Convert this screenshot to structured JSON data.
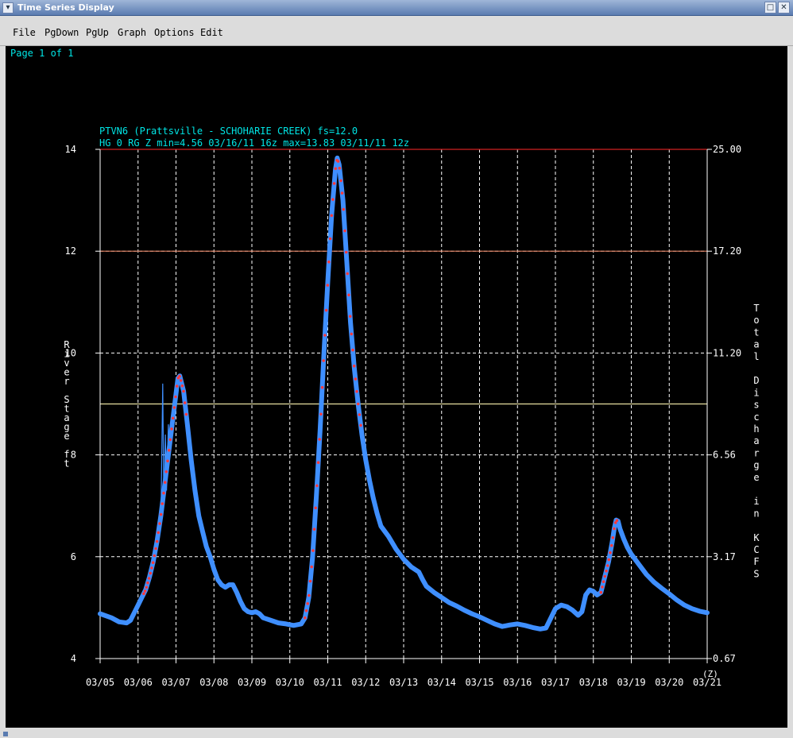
{
  "window": {
    "title": "Time Series Display",
    "sys_icon": "chevron-down-icon",
    "buttons": [
      "maximize-icon",
      "close-icon"
    ]
  },
  "menu": [
    "File",
    "PgDown",
    "PgUp",
    "Graph",
    "Options",
    "Edit"
  ],
  "page_indicator": "Page 1 of 1",
  "colors": {
    "background": "#000000",
    "grid": "#ffffff",
    "text": "#ffffff",
    "header": "#00e5e5",
    "observed": "#3f8fff",
    "marker": "#ff3a3a",
    "line_major": "#d02020",
    "line_moderate": "#e08060",
    "line_flood": "#e8e0a0"
  },
  "chart_data": {
    "type": "line",
    "header_line1": "PTVN6 (Prattsville - SCHOHARIE CREEK) fs=12.0",
    "header_line2": "HG 0 RG Z min=4.56 03/16/11 16z max=13.83 03/11/11 12z",
    "ylabel_left": "River Stage ft",
    "ylabel_right": "Total Discharge in KCFS",
    "x_unit": "(Z)",
    "x_ticks": [
      "03/05",
      "03/06",
      "03/07",
      "03/08",
      "03/09",
      "03/10",
      "03/11",
      "03/12",
      "03/13",
      "03/14",
      "03/15",
      "03/16",
      "03/17",
      "03/18",
      "03/19",
      "03/20",
      "03/21"
    ],
    "y_ticks_left": [
      "4",
      "6",
      "8",
      "10",
      "12",
      "14"
    ],
    "y_ticks_right": [
      "0.67",
      "3.17",
      "6.56",
      "11.20",
      "17.20",
      "25.00"
    ],
    "ylim": [
      4,
      14
    ],
    "xlim_days": [
      0,
      16
    ],
    "threshold_lines": [
      {
        "value": 14.0,
        "kind": "major"
      },
      {
        "value": 12.0,
        "kind": "moderate"
      },
      {
        "value": 9.0,
        "kind": "flood"
      }
    ],
    "series": [
      {
        "name": "HG 0 RG Z",
        "points": [
          [
            0.0,
            4.88
          ],
          [
            0.3,
            4.8
          ],
          [
            0.5,
            4.72
          ],
          [
            0.7,
            4.7
          ],
          [
            0.8,
            4.75
          ],
          [
            0.9,
            4.9
          ],
          [
            1.0,
            5.05
          ],
          [
            1.1,
            5.2
          ],
          [
            1.2,
            5.35
          ],
          [
            1.3,
            5.6
          ],
          [
            1.4,
            5.9
          ],
          [
            1.5,
            6.3
          ],
          [
            1.6,
            6.8
          ],
          [
            1.7,
            7.4
          ],
          [
            1.8,
            8.0
          ],
          [
            1.9,
            8.6
          ],
          [
            2.0,
            9.2
          ],
          [
            2.05,
            9.5
          ],
          [
            2.1,
            9.55
          ],
          [
            2.2,
            9.25
          ],
          [
            2.3,
            8.6
          ],
          [
            2.4,
            7.9
          ],
          [
            2.5,
            7.3
          ],
          [
            2.6,
            6.8
          ],
          [
            2.7,
            6.5
          ],
          [
            2.8,
            6.2
          ],
          [
            2.9,
            6.0
          ],
          [
            3.0,
            5.75
          ],
          [
            3.1,
            5.55
          ],
          [
            3.2,
            5.45
          ],
          [
            3.3,
            5.4
          ],
          [
            3.4,
            5.45
          ],
          [
            3.5,
            5.45
          ],
          [
            3.6,
            5.3
          ],
          [
            3.7,
            5.12
          ],
          [
            3.8,
            4.98
          ],
          [
            3.9,
            4.92
          ],
          [
            4.0,
            4.9
          ],
          [
            4.1,
            4.92
          ],
          [
            4.2,
            4.88
          ],
          [
            4.3,
            4.8
          ],
          [
            4.5,
            4.75
          ],
          [
            4.7,
            4.7
          ],
          [
            4.9,
            4.68
          ],
          [
            5.1,
            4.65
          ],
          [
            5.3,
            4.68
          ],
          [
            5.4,
            4.8
          ],
          [
            5.5,
            5.2
          ],
          [
            5.6,
            6.0
          ],
          [
            5.7,
            7.2
          ],
          [
            5.8,
            8.5
          ],
          [
            5.9,
            10.0
          ],
          [
            6.0,
            11.4
          ],
          [
            6.1,
            12.7
          ],
          [
            6.2,
            13.6
          ],
          [
            6.25,
            13.83
          ],
          [
            6.3,
            13.7
          ],
          [
            6.4,
            13.0
          ],
          [
            6.5,
            11.8
          ],
          [
            6.6,
            10.6
          ],
          [
            6.7,
            9.7
          ],
          [
            6.8,
            9.0
          ],
          [
            6.9,
            8.4
          ],
          [
            7.0,
            7.9
          ],
          [
            7.1,
            7.5
          ],
          [
            7.2,
            7.15
          ],
          [
            7.3,
            6.85
          ],
          [
            7.4,
            6.6
          ],
          [
            7.6,
            6.4
          ],
          [
            7.8,
            6.15
          ],
          [
            8.0,
            5.95
          ],
          [
            8.2,
            5.8
          ],
          [
            8.4,
            5.7
          ],
          [
            8.5,
            5.55
          ],
          [
            8.6,
            5.42
          ],
          [
            8.8,
            5.3
          ],
          [
            9.0,
            5.2
          ],
          [
            9.2,
            5.1
          ],
          [
            9.4,
            5.03
          ],
          [
            9.6,
            4.95
          ],
          [
            9.8,
            4.88
          ],
          [
            10.0,
            4.82
          ],
          [
            10.2,
            4.75
          ],
          [
            10.4,
            4.68
          ],
          [
            10.6,
            4.63
          ],
          [
            10.8,
            4.66
          ],
          [
            11.0,
            4.68
          ],
          [
            11.2,
            4.65
          ],
          [
            11.4,
            4.61
          ],
          [
            11.6,
            4.58
          ],
          [
            11.75,
            4.6
          ],
          [
            11.85,
            4.75
          ],
          [
            12.0,
            4.98
          ],
          [
            12.15,
            5.05
          ],
          [
            12.3,
            5.02
          ],
          [
            12.45,
            4.95
          ],
          [
            12.6,
            4.85
          ],
          [
            12.7,
            4.92
          ],
          [
            12.8,
            5.25
          ],
          [
            12.9,
            5.35
          ],
          [
            13.0,
            5.32
          ],
          [
            13.1,
            5.25
          ],
          [
            13.2,
            5.3
          ],
          [
            13.3,
            5.6
          ],
          [
            13.4,
            5.9
          ],
          [
            13.5,
            6.3
          ],
          [
            13.55,
            6.55
          ],
          [
            13.6,
            6.72
          ],
          [
            13.65,
            6.7
          ],
          [
            13.7,
            6.55
          ],
          [
            13.8,
            6.35
          ],
          [
            13.9,
            6.18
          ],
          [
            14.0,
            6.05
          ],
          [
            14.2,
            5.85
          ],
          [
            14.4,
            5.65
          ],
          [
            14.6,
            5.5
          ],
          [
            14.8,
            5.38
          ],
          [
            15.0,
            5.27
          ],
          [
            15.2,
            5.15
          ],
          [
            15.4,
            5.05
          ],
          [
            15.6,
            4.98
          ],
          [
            15.8,
            4.93
          ],
          [
            16.0,
            4.9
          ]
        ],
        "spike": [
          [
            1.6,
            6.6
          ],
          [
            1.65,
            9.4
          ],
          [
            1.68,
            7.0
          ],
          [
            1.72,
            8.4
          ],
          [
            1.75,
            7.3
          ],
          [
            1.8,
            8.6
          ],
          [
            1.83,
            7.9
          ]
        ],
        "markers_x_ranges": [
          [
            1.15,
            2.3
          ],
          [
            5.4,
            6.9
          ],
          [
            13.2,
            13.65
          ]
        ]
      }
    ]
  }
}
